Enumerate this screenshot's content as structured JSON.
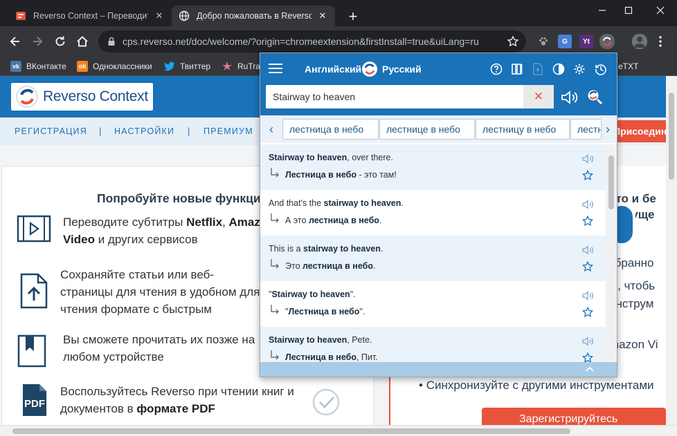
{
  "browser": {
    "tabs": [
      {
        "title": "Reverso Context – Переводите в контексте",
        "active": false
      },
      {
        "title": "Добро пожаловать в Reverso Context",
        "active": true
      }
    ],
    "url": "cps.reverso.net/doc/welcome/?origin=chromeextension&firstInstall=true&uiLang=ru",
    "bookmarks": [
      "ВКонтакте",
      "Одноклассники",
      "Твиттер",
      "RuTracker"
    ],
    "bookmark_overflow": "eTXT",
    "extensions": {
      "translate": "G",
      "yt": "Yt"
    }
  },
  "page": {
    "logo_text": "Reverso Context",
    "nav": [
      "РЕГИСТРАЦИЯ",
      "НАСТРОЙКИ",
      "ПРЕМИУМ"
    ],
    "nav_separator": "|",
    "join_button": "Присоединиться",
    "features_title": "Попробуйте новые функции",
    "features": [
      {
        "pre": "Переводите субтитры ",
        "b1": "Netflix",
        "mid": ", ",
        "b2": "Amazon Prime",
        "line2b": "Video",
        "post": " и других сервисов"
      },
      {
        "text": "Сохраняйте статьи или веб-страницы для чтения в удобном для чтения формате с быстрым доступом ко всем функциям перевода"
      },
      {
        "text": "Вы сможете прочитать их позже на любом устройстве"
      },
      {
        "pre": "Воспользуйтесь Reverso при чтении книг и документов в ",
        "b1": "формате PDF"
      }
    ],
    "right_lines": [
      "сто и бе",
      "еимуще",
      "в",
      "збранно",
      "ы, чтобь",
      "инструм",
      "mazon Vi"
    ],
    "right_bullet": "Синхронизуйте с другими инструментами",
    "register_button": "Зарегистрируйтесь"
  },
  "popup": {
    "source_lang": "Английский",
    "target_lang": "Русский",
    "query": "Stairway to heaven",
    "suggestions": [
      "лестница в небо",
      "лестнице в небо",
      "лестницу в небо",
      "лестницы в небо"
    ],
    "examples": [
      {
        "src_hl": "Stairway to heaven",
        "src_rest": ", over there.",
        "tgt_hl": "Лестница в небо",
        "tgt_rest": " - это там!"
      },
      {
        "src_pre": "And that's the ",
        "src_hl": "stairway to heaven",
        "src_rest": ".",
        "tgt_pre": "А это ",
        "tgt_hl": "лестница в небо",
        "tgt_rest": "."
      },
      {
        "src_pre": "This is a ",
        "src_hl": "stairway to heaven",
        "src_rest": ".",
        "tgt_pre": "Это ",
        "tgt_hl": "лестница в небо",
        "tgt_rest": "."
      },
      {
        "src_pre": "\"",
        "src_hl": "Stairway to heaven",
        "src_rest": "\".",
        "tgt_pre": "\"",
        "tgt_hl": "Лестница в небо",
        "tgt_rest": "\"."
      },
      {
        "src_hl": "Stairway to heaven",
        "src_rest": ", Pete.",
        "tgt_hl": "Лестница в небо",
        "tgt_rest": ", Пит."
      }
    ]
  },
  "colors": {
    "brand_blue": "#1a72b8",
    "accent_red": "#e8533c"
  }
}
